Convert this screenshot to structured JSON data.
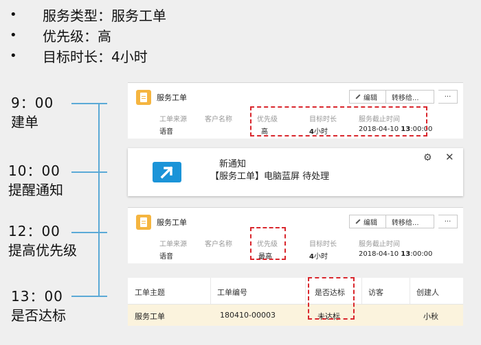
{
  "bullets": [
    {
      "dot": "•",
      "text": "服务类型：服务工单"
    },
    {
      "dot": "•",
      "text": "优先级：高"
    },
    {
      "dot": "•",
      "text": "目标时长：4小时"
    }
  ],
  "timeline": [
    {
      "time": "9：00",
      "event": "建单"
    },
    {
      "time": "10：00",
      "event": "提醒通知"
    },
    {
      "time": "12：00",
      "event": "提高优先级"
    },
    {
      "time": "13：00",
      "event": "是否达标"
    }
  ],
  "card1": {
    "title": "服务工单",
    "edit_label": "编辑",
    "transfer_label": "转移给...",
    "more_label": "···",
    "labels": [
      "工单来源",
      "客户名称",
      "优先级",
      "目标时长",
      "服务截止时间"
    ],
    "source": "语音",
    "priority": "高",
    "duration_num": "4",
    "duration_unit": "小时",
    "deadline_date": "2018-04-10 ",
    "deadline_hour": "13",
    "deadline_rest": ":00:00"
  },
  "notice": {
    "title": "新通知",
    "body": "【服务工单】电脑蓝屏 待处理",
    "gear": "⚙",
    "close": "✕"
  },
  "card2": {
    "title": "服务工单",
    "edit_label": "编辑",
    "transfer_label": "转移给...",
    "more_label": "···",
    "labels": [
      "工单来源",
      "客户名称",
      "优先级",
      "目标时长",
      "服务截止时间"
    ],
    "source": "语音",
    "priority": "最高",
    "duration_num": "4",
    "duration_unit": "小时",
    "deadline_date": "2018-04-10 ",
    "deadline_hour": "13",
    "deadline_rest": ":00:00"
  },
  "table": {
    "headers": [
      "工单主题",
      "工单编号",
      "是否达标",
      "访客",
      "创建人"
    ],
    "row": [
      "服务工单",
      "180410-00003",
      "未达标",
      "",
      "小秋"
    ]
  },
  "colors": {
    "accent_line": "#5aa9d6",
    "highlight_dash": "#d9262c",
    "notice_icon": "#1b94d8",
    "doc_icon": "#f5b540"
  }
}
